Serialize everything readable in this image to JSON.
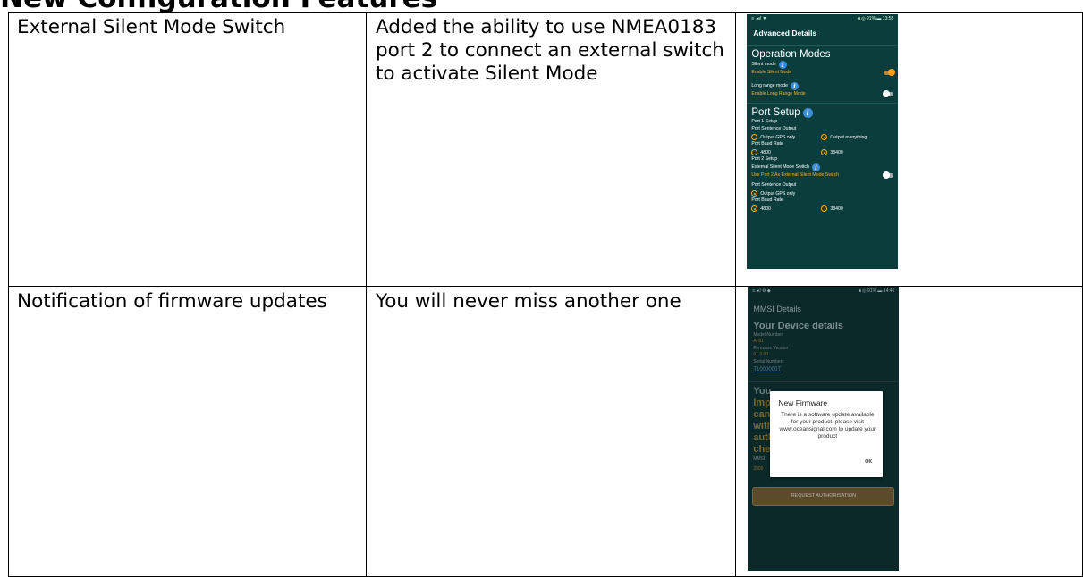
{
  "heading": "New Configuration Features",
  "rows": [
    {
      "feature": "External Silent Mode Switch",
      "description": "Added the ability to use NMEA0183 port 2 to connect an external switch to activate Silent Mode"
    },
    {
      "feature": "Notification of firmware updates",
      "description": "You will never miss another one"
    }
  ],
  "phone1": {
    "status_left": "≡ .◂ıl ▼",
    "status_right": "■ ◎ 91% ▬ 13:55",
    "appbar_title": "Advanced Details",
    "operation_modes": "Operation Modes",
    "silent_mode": "Silent mode",
    "enable_silent": "Enable Silent Mode",
    "long_range_mode": "Long range mode",
    "enable_long_range": "Enable Long Range Mode",
    "port_setup": "Port Setup",
    "port1_setup": "Port 1 Setup",
    "port_sentence_output": "Port Sentence Output",
    "output_gps_only": "Output GPS only",
    "output_everything": "Output everything",
    "port_baud_rate": "Port Baud Rate",
    "baud_4800": "4800",
    "baud_38400": "38400",
    "port2_setup": "Port 2 Setup",
    "ext_silent_switch": "External Silent Mode Switch",
    "use_port2": "Use Port 2 As External Silent Mode Switch",
    "port2_sentence_output": "Port Sentence Output",
    "port2_output_gps_only": "Output GPS only",
    "port2_baud_rate": "Port Baud Rate",
    "port2_baud_4800": "4800",
    "port2_baud_38400": "38400"
  },
  "phone2": {
    "status_left": "≡.◂ıl ⚙ ◆",
    "status_right": "■ ◎ 91% ▬ 14:46",
    "appbar_title": "MMSI Details",
    "device_details": "Your Device details",
    "model_number_label": "Model Number:",
    "model_number": "AT81",
    "firmware_label": "Firmware Version",
    "firmware": "01.3.00",
    "serial_label": "Serial Number:",
    "serial": "T1000000T",
    "bg_line1": "You",
    "bg_line2": "Imp",
    "bg_line3": "can",
    "bg_line4": "with",
    "bg_line5": "auth",
    "bg_line6": "chec",
    "bg_mmsi": "MMSI",
    "bg_num": "2000",
    "dialog_title": "New Firmware",
    "dialog_body": "There is a software update available for your product, please visit www.oceansignal.com to update your product",
    "dialog_ok": "OK",
    "request_button": "REQUEST AUTHORISATION"
  }
}
